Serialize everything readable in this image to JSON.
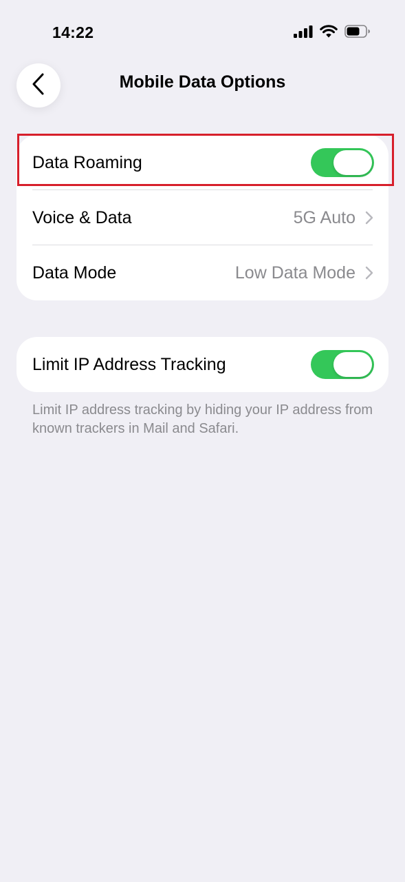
{
  "status_bar": {
    "time": "14:22",
    "icons": [
      "cellular-signal-icon",
      "wifi-icon",
      "battery-icon"
    ]
  },
  "nav": {
    "back_icon": "chevron-left-icon",
    "title": "Mobile Data Options"
  },
  "group1": {
    "rows": [
      {
        "label": "Data Roaming",
        "control": "toggle",
        "on": true
      },
      {
        "label": "Voice & Data",
        "value": "5G Auto",
        "control": "chevron"
      },
      {
        "label": "Data Mode",
        "value": "Low Data Mode",
        "control": "chevron"
      }
    ]
  },
  "group2": {
    "rows": [
      {
        "label": "Limit IP Address Tracking",
        "control": "toggle",
        "on": true
      }
    ],
    "footer": "Limit IP address tracking by hiding your IP address from known trackers in Mail and Safari."
  },
  "colors": {
    "background": "#f0eff5",
    "toggle_on": "#34c759",
    "secondary_text": "#8a8a8e",
    "highlight": "#d71f2b"
  }
}
